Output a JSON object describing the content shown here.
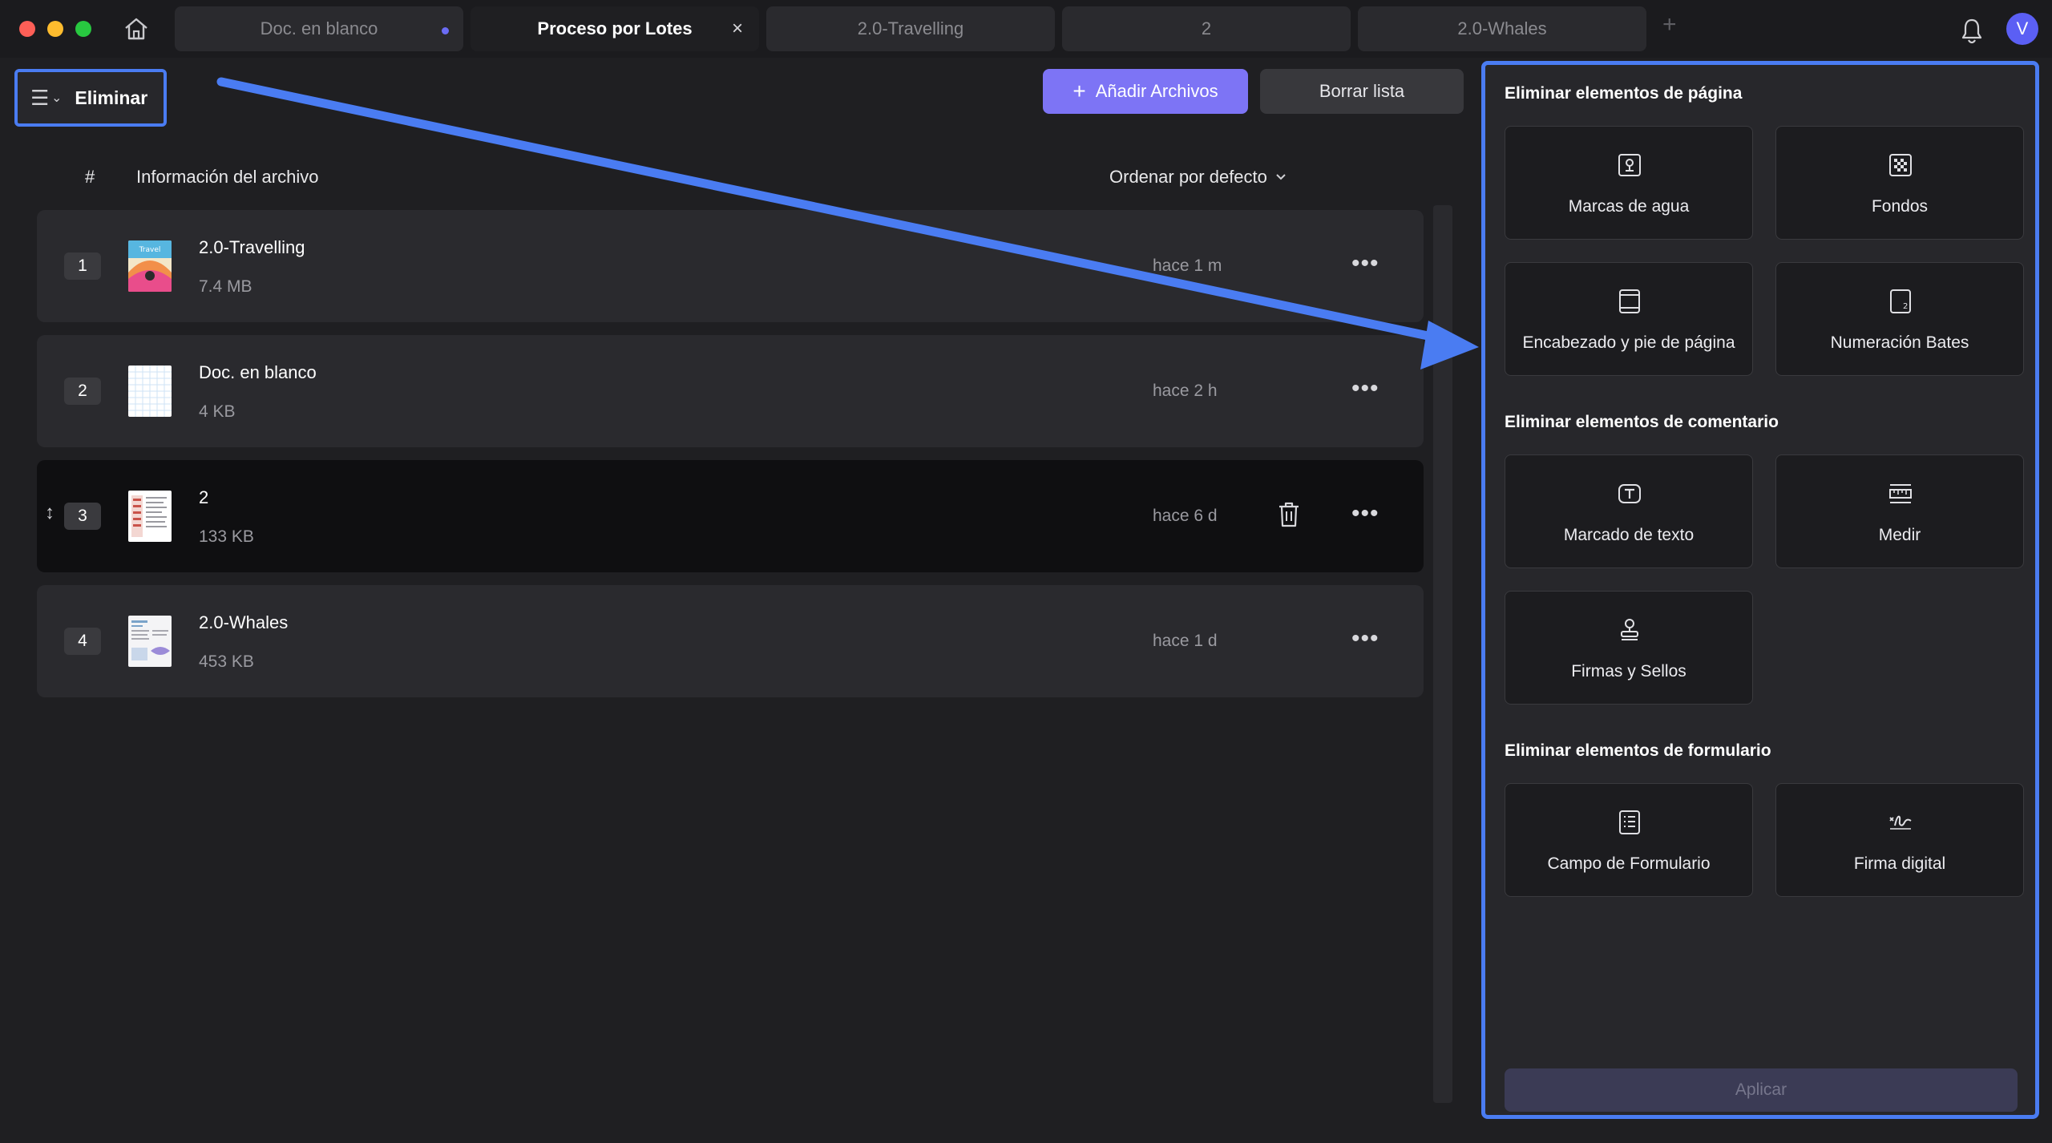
{
  "tabs": [
    {
      "label": "Doc. en blanco",
      "unsaved": true
    },
    {
      "label": "Proceso por Lotes",
      "active": true,
      "close": "×"
    },
    {
      "label": "2.0-Travelling"
    },
    {
      "label": "2"
    },
    {
      "label": "2.0-Whales"
    }
  ],
  "tab_add": "+",
  "user_initial": "V",
  "toolbar": {
    "mode_label": "Eliminar",
    "add_files": "Añadir Archivos",
    "clear_list": "Borrar lista"
  },
  "list_header": {
    "index": "#",
    "info": "Información del archivo",
    "sort": "Ordenar por defecto"
  },
  "files": [
    {
      "num": "1",
      "name": "2.0-Travelling",
      "size": "7.4 MB",
      "time": "hace 1 m"
    },
    {
      "num": "2",
      "name": "Doc. en blanco",
      "size": "4 KB",
      "time": "hace 2 h"
    },
    {
      "num": "3",
      "name": "2",
      "size": "133 KB",
      "time": "hace 6 d",
      "selected": true
    },
    {
      "num": "4",
      "name": "2.0-Whales",
      "size": "453 KB",
      "time": "hace 1 d"
    }
  ],
  "more_glyph": "•••",
  "panel": {
    "page_section": "Eliminar elementos de página",
    "page_items": [
      "Marcas de agua",
      "Fondos",
      "Encabezado y pie de página",
      "Numeración Bates"
    ],
    "comment_section": "Eliminar elementos de comentario",
    "comment_items": [
      "Marcado de texto",
      "Medir",
      "Firmas y Sellos"
    ],
    "form_section": "Eliminar elementos de formulario",
    "form_items": [
      "Campo de Formulario",
      "Firma digital"
    ],
    "apply": "Aplicar"
  },
  "colors": {
    "accent": "#7d74f5",
    "highlight_border": "#4a7cf2",
    "background": "#1f1f22"
  }
}
